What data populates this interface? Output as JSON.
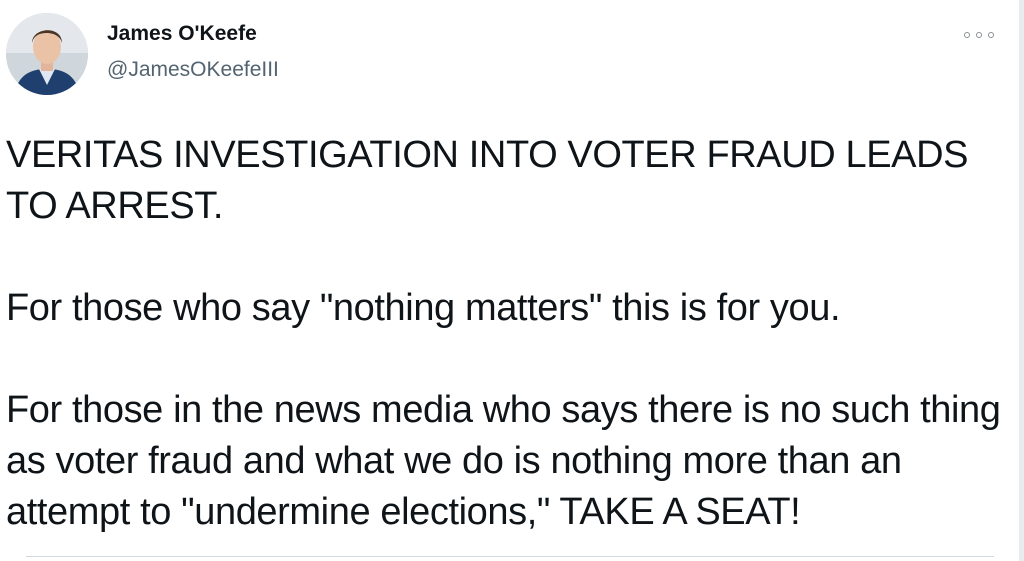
{
  "author": {
    "display_name": "James O'Keefe",
    "handle": "@JamesOKeefeIII",
    "avatar_icon": "profile-photo"
  },
  "more_icon": "more-options-icon",
  "tweet": {
    "paragraphs": [
      "VERITAS INVESTIGATION INTO VOTER FRAUD LEADS TO ARREST.",
      "For those who say \"nothing matters\" this is for you.",
      "For those in the news media who says there is no such thing as voter fraud and what we do is nothing more than an attempt to \"undermine elections,\" TAKE A SEAT!"
    ]
  },
  "colors": {
    "text": "#0f1419",
    "secondary_text": "#536471",
    "divider": "#cfd9de"
  }
}
